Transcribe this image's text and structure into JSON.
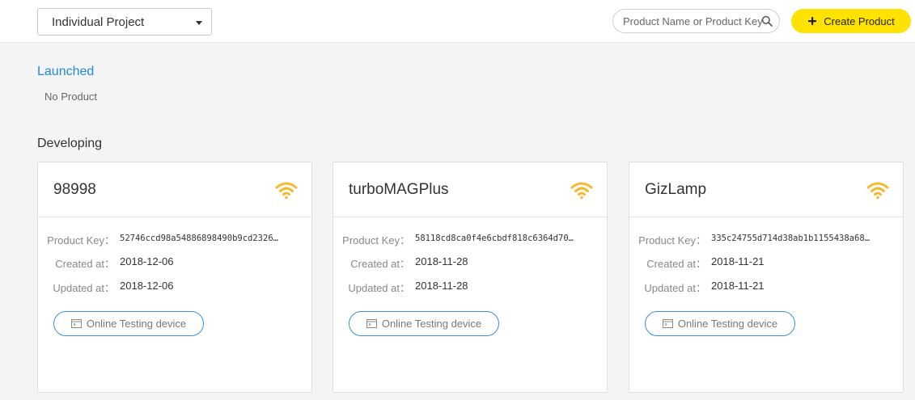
{
  "header": {
    "project_select": "Individual Project",
    "search_placeholder": "Product Name or Product Key",
    "create_label": "Create Product"
  },
  "sections": {
    "launched": "Launched",
    "launched_empty": "No Product",
    "developing": "Developing"
  },
  "labels": {
    "product_key": "Product Key：",
    "created_at": "Created at：",
    "updated_at": "Updated at：",
    "test_button": "Online Testing device"
  },
  "products": [
    {
      "name": "98998",
      "product_key": "52746ccd98a54886898490b9cd2326…",
      "created": "2018-12-06",
      "updated": "2018-12-06"
    },
    {
      "name": "turboMAGPlus",
      "product_key": "58118cd8ca0f4e6cbdf818c6364d70…",
      "created": "2018-11-28",
      "updated": "2018-11-28"
    },
    {
      "name": "GizLamp",
      "product_key": "335c24755d714d38ab1b1155438a68…",
      "created": "2018-11-21",
      "updated": "2018-11-21"
    }
  ],
  "colors": {
    "accent": "#ffe200",
    "link": "#1f8ad6",
    "wifi": "#f5b92f",
    "outline_button": "#3a8fd6"
  }
}
